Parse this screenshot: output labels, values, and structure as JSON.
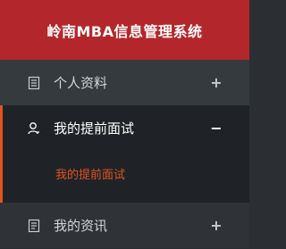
{
  "header": {
    "title": "岭南MBA信息管理系统"
  },
  "menu": {
    "items": [
      {
        "label": "个人资料",
        "icon": "document-icon",
        "toggle": "+"
      },
      {
        "label": "我的提前面试",
        "icon": "user-icon",
        "toggle": "−",
        "subitems": [
          {
            "label": "我的提前面试"
          }
        ]
      },
      {
        "label": "我的资讯",
        "icon": "news-icon",
        "toggle": "+"
      }
    ]
  },
  "colors": {
    "header_bg": "#b3272c",
    "sidebar_bg": "#2b2f33",
    "active_bg": "#1f2327",
    "accent": "#e2531f"
  }
}
